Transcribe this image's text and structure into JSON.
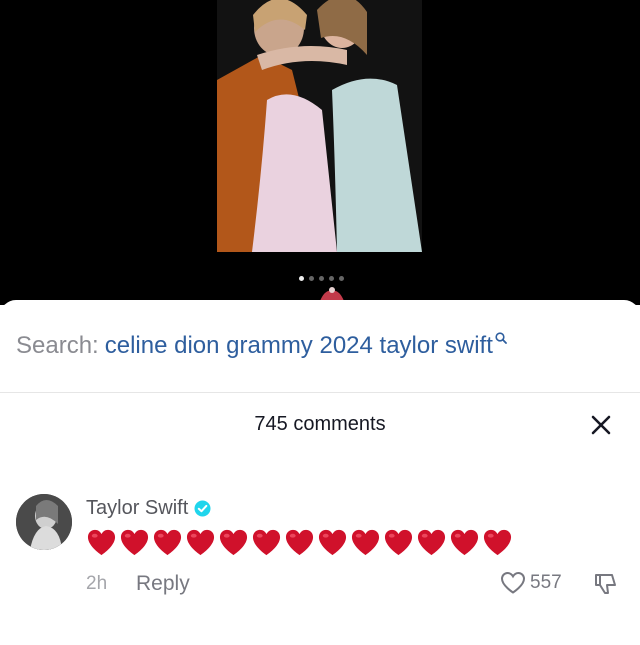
{
  "media": {
    "icon": "photo",
    "carousel_dots": 5,
    "active_dot": 0
  },
  "search": {
    "prefix": "Search:",
    "query": "celine dion grammy 2024 taylor swift",
    "icon": "search-icon"
  },
  "comments_header": {
    "count_label": "745 comments",
    "close_icon": "close-icon"
  },
  "comment": {
    "author": "Taylor Swift",
    "verified": true,
    "hearts": [
      "❤",
      "❤",
      "❤",
      "❤",
      "❤",
      "❤",
      "❤",
      "❤",
      "❤",
      "❤",
      "❤",
      "❤",
      "❤"
    ],
    "time": "2h",
    "reply_label": "Reply",
    "like_count": "557",
    "heart_color": "#d0112b",
    "verified_color": "#20d5ec"
  }
}
